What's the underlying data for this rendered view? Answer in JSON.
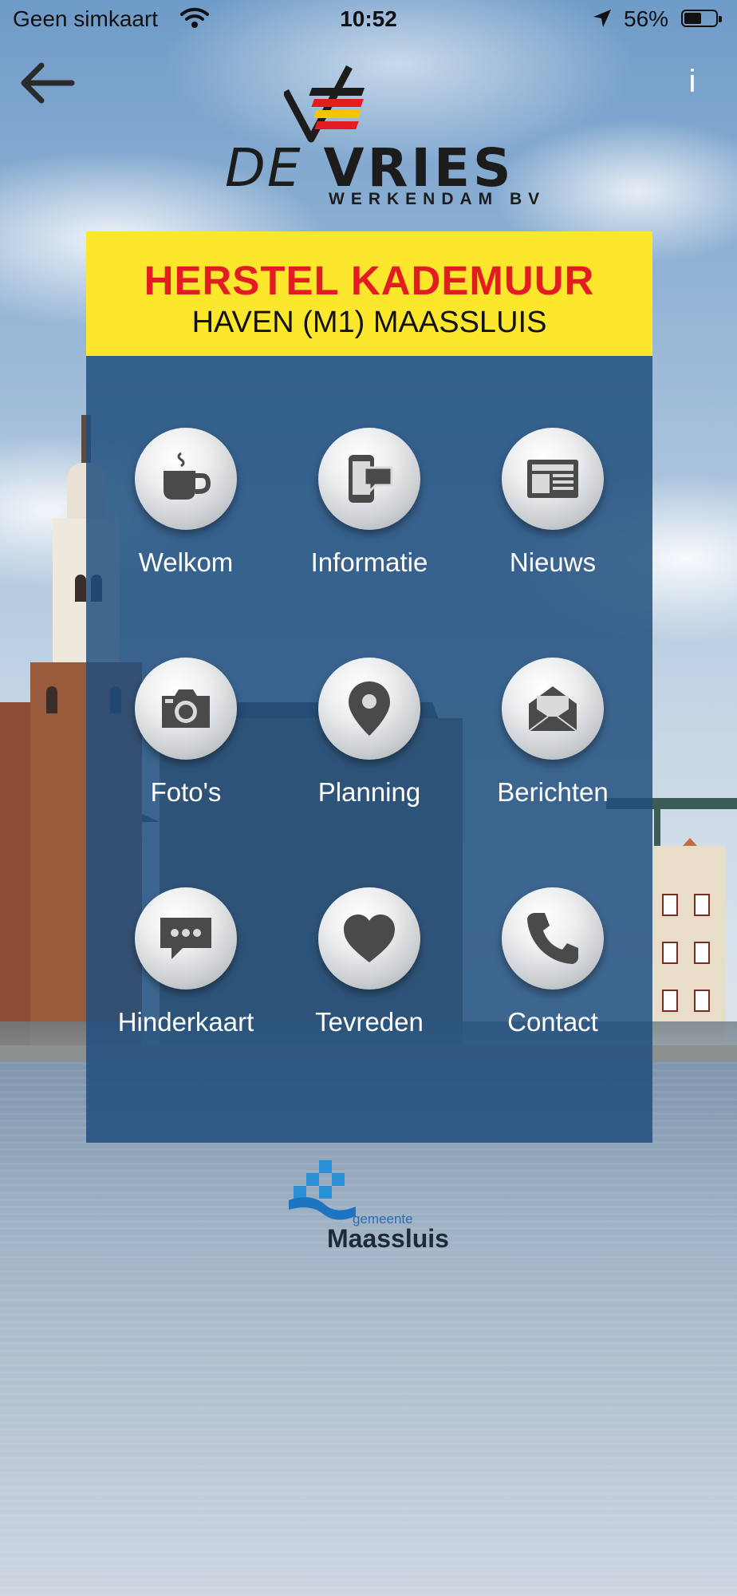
{
  "status_bar": {
    "carrier": "Geen simkaart",
    "time": "10:52",
    "battery_percent": "56%",
    "battery_level": 0.56
  },
  "header": {
    "back_icon": "arrow-left-icon",
    "info_label": "i"
  },
  "logo": {
    "brand_de": "DE",
    "brand_name": "VRIES",
    "brand_sub": "WERKENDAM BV"
  },
  "banner": {
    "title": "HERSTEL KADEMUUR",
    "subtitle": "HAVEN (M1) MAASSLUIS"
  },
  "menu": [
    {
      "label": "Welkom",
      "icon": "coffee-cup-icon"
    },
    {
      "label": "Informatie",
      "icon": "phone-chat-icon"
    },
    {
      "label": "Nieuws",
      "icon": "newspaper-icon"
    },
    {
      "label": "Foto's",
      "icon": "camera-icon"
    },
    {
      "label": "Planning",
      "icon": "location-pin-icon"
    },
    {
      "label": "Berichten",
      "icon": "envelope-icon"
    },
    {
      "label": "Hinderkaart",
      "icon": "speech-bubble-icon"
    },
    {
      "label": "Tevreden",
      "icon": "heart-icon"
    },
    {
      "label": "Contact",
      "icon": "phone-handset-icon"
    }
  ],
  "footer": {
    "gemeente_small": "gemeente",
    "gemeente_name": "Maassluis"
  },
  "colors": {
    "banner_bg": "#fde72c",
    "banner_title": "#e31b23",
    "panel_bg": "#1f4e7d",
    "logo_red": "#e31b23",
    "logo_yellow": "#f6c500",
    "gemeente_blue": "#2a8fd6"
  }
}
